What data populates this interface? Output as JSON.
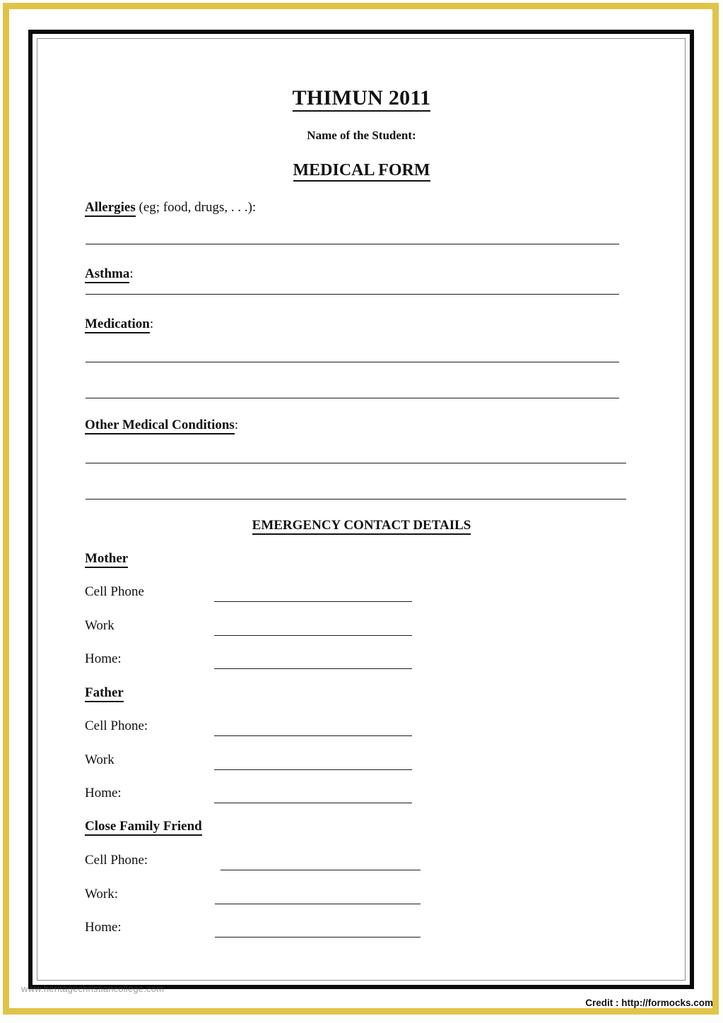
{
  "document": {
    "title": "THIMUN 2011",
    "student_name_label": "Name of the Student:",
    "form_title": "MEDICAL FORM"
  },
  "medical_section": {
    "fields": [
      {
        "key": "Allergies",
        "rest": " (eg; food, drugs, . . .):",
        "lines": 1
      },
      {
        "key": "Asthma",
        "rest": ":",
        "lines": 1
      },
      {
        "key": "Medication",
        "rest": ":",
        "lines": 2
      },
      {
        "key": "Other Medical Conditions",
        "rest": ":",
        "lines": 2
      }
    ]
  },
  "emergency_section": {
    "heading": "EMERGENCY CONTACT DETAILS",
    "groups": [
      {
        "name": "Mother",
        "rows": [
          {
            "label": "Cell Phone"
          },
          {
            "label": "Work"
          },
          {
            "label": "Home:"
          }
        ]
      },
      {
        "name": "Father",
        "rows": [
          {
            "label": "Cell Phone:"
          },
          {
            "label": "Work"
          },
          {
            "label": "Home:"
          }
        ]
      },
      {
        "name": "Close Family Friend",
        "rows": [
          {
            "label": "Cell Phone:"
          },
          {
            "label": "Work:"
          },
          {
            "label": "Home:"
          }
        ]
      }
    ]
  },
  "footer": {
    "watermark": "www.heritagechristiancollege.com",
    "credit": "Credit : http://formocks.com"
  },
  "colors": {
    "border_gold": "#e0c44a",
    "frame_black": "#0a0a0a",
    "text": "#111111",
    "paper": "#ffffff"
  }
}
